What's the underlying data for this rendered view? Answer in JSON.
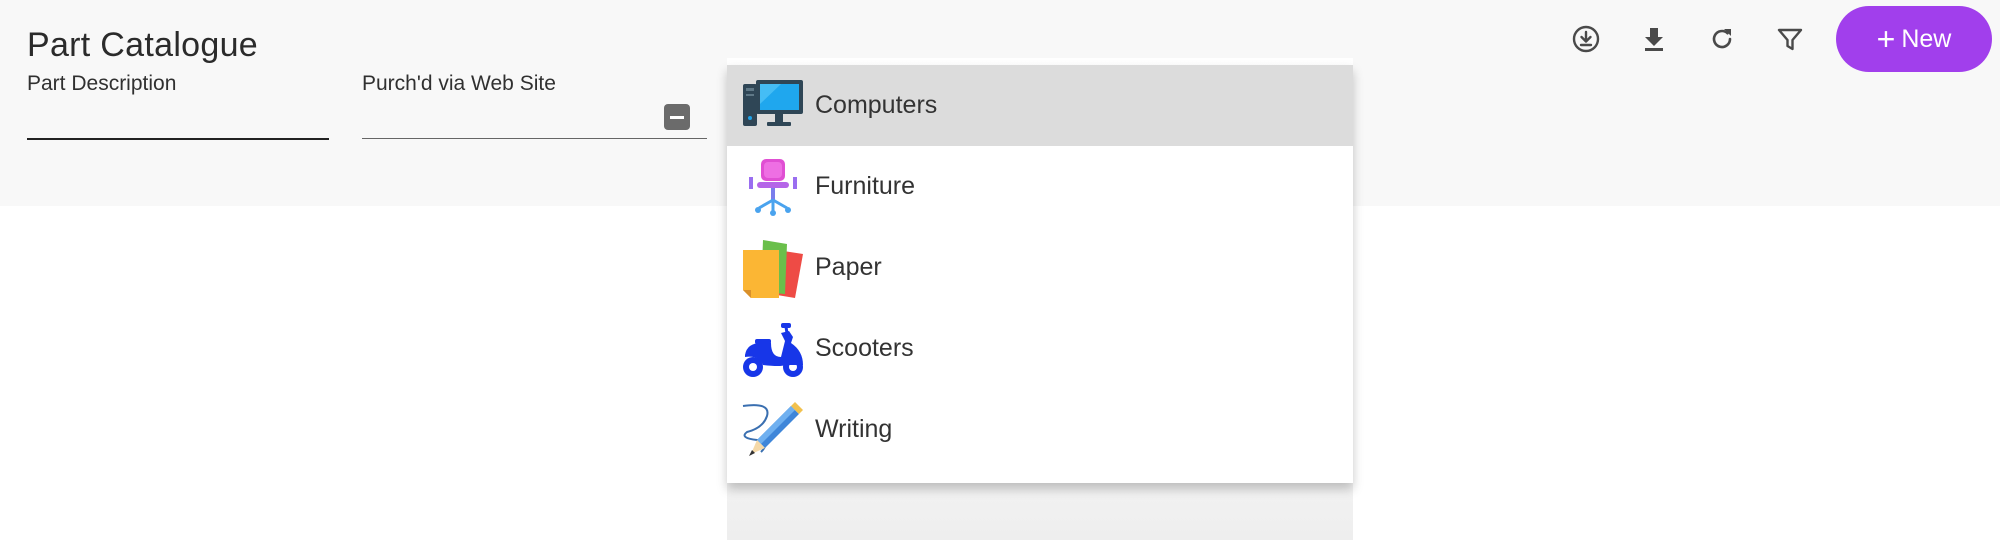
{
  "page": {
    "title": "Part Catalogue"
  },
  "filters": {
    "part_description": {
      "label": "Part Description",
      "value": ""
    },
    "purchased_via_web": {
      "label": "Purch'd via Web Site",
      "value": ""
    }
  },
  "toolbar": {
    "buttons": [
      {
        "name": "download-circle-icon"
      },
      {
        "name": "download-icon"
      },
      {
        "name": "refresh-icon"
      },
      {
        "name": "filter-icon"
      }
    ],
    "new_label": "New",
    "accent_color": "#a13fec"
  },
  "dropdown": {
    "selected_index": 0,
    "items": [
      {
        "label": "Computers",
        "icon": "computer-icon"
      },
      {
        "label": "Furniture",
        "icon": "office-chair-icon"
      },
      {
        "label": "Paper",
        "icon": "paper-stack-icon"
      },
      {
        "label": "Scooters",
        "icon": "scooter-icon"
      },
      {
        "label": "Writing",
        "icon": "pencil-icon"
      }
    ]
  }
}
